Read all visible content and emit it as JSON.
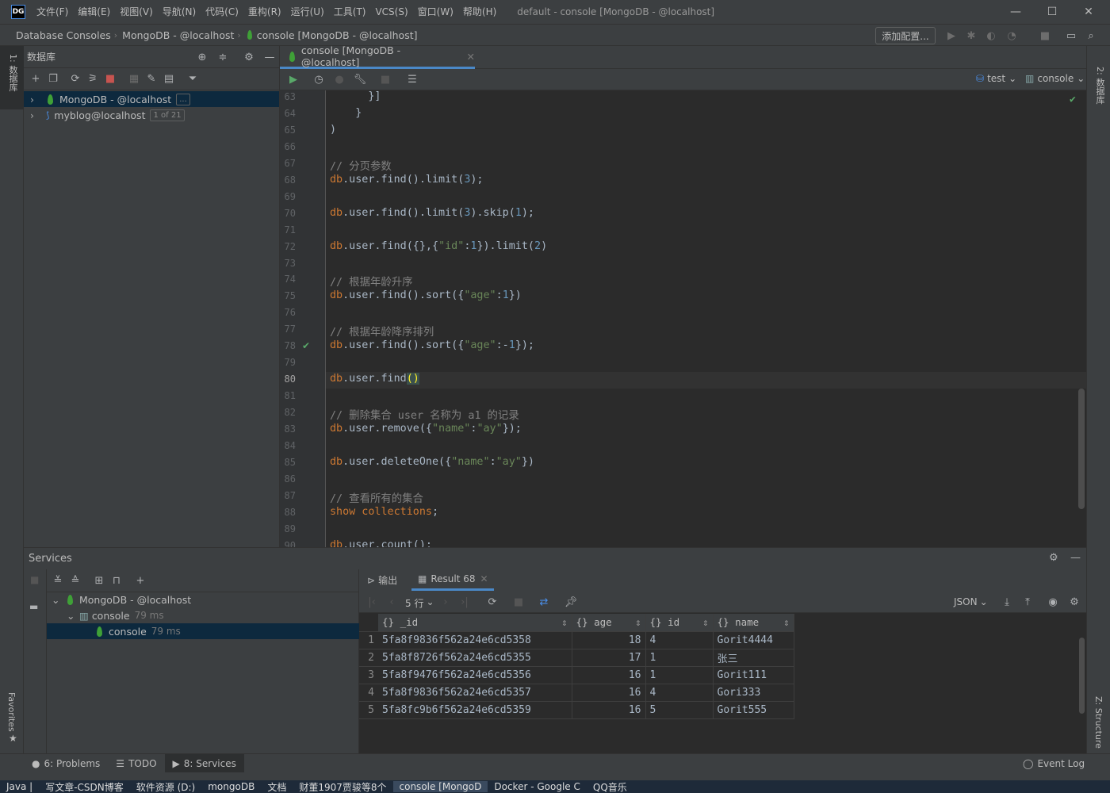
{
  "app": {
    "logo_text": "DG",
    "menu": [
      "文件(F)",
      "编辑(E)",
      "视图(V)",
      "导航(N)",
      "代码(C)",
      "重构(R)",
      "运行(U)",
      "工具(T)",
      "VCS(S)",
      "窗口(W)",
      "帮助(H)"
    ],
    "window_title": "default - console [MongoDB - @localhost]"
  },
  "navbar": {
    "breadcrumbs": [
      "Database Consoles",
      "MongoDB - @localhost",
      "console [MongoDB - @localhost]"
    ],
    "add_config_label": "添加配置..."
  },
  "left_stripe": {
    "db_tab": "1: 数据库",
    "favorites": "Favorites"
  },
  "right_stripe": {
    "db_tab": "2: 数据库",
    "structure": "Z: Structure"
  },
  "db_panel": {
    "title": "数据库",
    "tree": [
      {
        "label": "MongoDB - @localhost",
        "badge": "...",
        "selected": true
      },
      {
        "label": "myblog@localhost",
        "badge": "1 of 21",
        "selected": false
      }
    ]
  },
  "editor": {
    "tab_label": "console [MongoDB - @localhost]",
    "schema_label": "test",
    "session_label": "console",
    "current_line": 80,
    "lines": [
      {
        "n": 63,
        "html": "      }]"
      },
      {
        "n": 64,
        "html": "    }"
      },
      {
        "n": 65,
        "html": ")"
      },
      {
        "n": 66,
        "html": ""
      },
      {
        "n": 67,
        "html": "<span class=\"cm\">// 分页参数</span>"
      },
      {
        "n": 68,
        "html": "<span class=\"kw\">db</span>.user.find().limit(<span class=\"nm\">3</span>);"
      },
      {
        "n": 69,
        "html": ""
      },
      {
        "n": 70,
        "html": "<span class=\"kw\">db</span>.user.find().limit(<span class=\"nm\">3</span>).skip(<span class=\"nm\">1</span>);"
      },
      {
        "n": 71,
        "html": ""
      },
      {
        "n": 72,
        "html": "<span class=\"kw\">db</span>.user.find({},{<span class=\"st\">\"id\"</span>:<span class=\"nm\">1</span>}).limit(<span class=\"nm\">2</span>)"
      },
      {
        "n": 73,
        "html": ""
      },
      {
        "n": 74,
        "html": "<span class=\"cm\">// 根据年龄升序</span>"
      },
      {
        "n": 75,
        "html": "<span class=\"kw\">db</span>.user.find().sort({<span class=\"st\">\"age\"</span>:<span class=\"nm\">1</span>})"
      },
      {
        "n": 76,
        "html": ""
      },
      {
        "n": 77,
        "html": "<span class=\"cm\">// 根据年龄降序排列</span>"
      },
      {
        "n": 78,
        "html": "<span class=\"kw\">db</span>.user.find().sort({<span class=\"st\">\"age\"</span>:-<span class=\"nm\">1</span>});"
      },
      {
        "n": 79,
        "html": ""
      },
      {
        "n": 80,
        "html": "<span class=\"kw\">db</span>.user.find<span style=\"background:#3b514d;color:#ffef28\">()</span>"
      },
      {
        "n": 81,
        "html": ""
      },
      {
        "n": 82,
        "html": "<span class=\"cm\">// 删除集合 user 名称为 a1 的记录</span>"
      },
      {
        "n": 83,
        "html": "<span class=\"kw\">db</span>.user.remove({<span class=\"st\">\"name\"</span>:<span class=\"st\">\"ay\"</span>});"
      },
      {
        "n": 84,
        "html": ""
      },
      {
        "n": 85,
        "html": "<span class=\"kw\">db</span>.user.deleteOne({<span class=\"st\">\"name\"</span>:<span class=\"st\">\"ay\"</span>})"
      },
      {
        "n": 86,
        "html": ""
      },
      {
        "n": 87,
        "html": "<span class=\"cm\">// 查看所有的集合</span>"
      },
      {
        "n": 88,
        "html": "<span class=\"kw\">show collections</span>;"
      },
      {
        "n": 89,
        "html": ""
      },
      {
        "n": 90,
        "html": "<span class=\"kw\">db</span>.user.count();"
      }
    ],
    "check_lines": [
      78
    ]
  },
  "services": {
    "title": "Services",
    "tree": [
      {
        "label": "MongoDB - @localhost",
        "time": ""
      },
      {
        "label": "console",
        "time": "79 ms"
      },
      {
        "label": "console",
        "time": "79 ms"
      }
    ],
    "tabs": [
      "输出",
      "Result 68"
    ],
    "rows_label": "5 行",
    "format_label": "JSON",
    "columns": [
      "_id",
      "age",
      "id",
      "name"
    ],
    "rows": [
      {
        "n": "1",
        "_id": "5fa8f9836f562a24e6cd5358",
        "age": "18",
        "id": "4",
        "name": "Gorit4444"
      },
      {
        "n": "2",
        "_id": "5fa8f8726f562a24e6cd5355",
        "age": "17",
        "id": "1",
        "name": "张三"
      },
      {
        "n": "3",
        "_id": "5fa8f9476f562a24e6cd5356",
        "age": "16",
        "id": "1",
        "name": "Gorit111"
      },
      {
        "n": "4",
        "_id": "5fa8f9836f562a24e6cd5357",
        "age": "16",
        "id": "4",
        "name": "Gori333"
      },
      {
        "n": "5",
        "_id": "5fa8fc9b6f562a24e6cd5359",
        "age": "16",
        "id": "5",
        "name": "Gorit555"
      }
    ]
  },
  "toolbar_bottom": {
    "problems": "6: Problems",
    "todo": "TODO",
    "services": "8: Services",
    "event_log": "Event Log"
  },
  "taskbar": {
    "items": [
      "Java |",
      "写文章-CSDN博客",
      "软件资源 (D:)",
      "mongoDB",
      "文档",
      "财董1907贾骏等8个",
      "console [MongoD",
      "Docker - Google C",
      "QQ音乐"
    ]
  },
  "colors": {
    "accent": "#4a88c7",
    "mongo_green": "#3fa037",
    "run_green": "#59a869",
    "stop_red": "#c75450"
  }
}
